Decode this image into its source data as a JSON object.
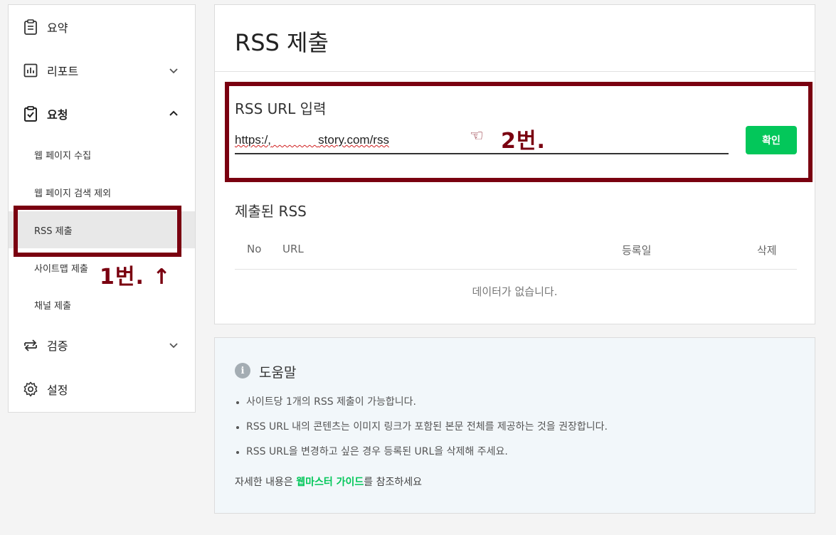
{
  "sidebar": {
    "items": [
      {
        "label": "요약",
        "icon": "clipboard-icon"
      },
      {
        "label": "리포트",
        "icon": "bar-chart-icon"
      },
      {
        "label": "요청",
        "icon": "clipboard-check-icon"
      },
      {
        "label": "검증",
        "icon": "swap-arrows-icon"
      },
      {
        "label": "설정",
        "icon": "gear-icon"
      }
    ],
    "sub_items": [
      "웹 페이지 수집",
      "웹 페이지 검색 제외",
      "RSS 제출",
      "사이트맵 제출",
      "채널 제출"
    ],
    "annotation": "1번.  ↑"
  },
  "main": {
    "title": "RSS 제출",
    "url_section": {
      "label": "RSS URL 입력",
      "value_prefix": "https:/,",
      "value_suffix": "story.com/rss",
      "pointer": "☜",
      "annotation": "2번.",
      "confirm_label": "확인"
    },
    "submitted": {
      "title": "제출된 RSS",
      "columns": [
        "No",
        "URL",
        "등록일",
        "삭제"
      ],
      "empty_message": "데이터가 없습니다."
    }
  },
  "help": {
    "icon_glyph": "i",
    "title": "도움말",
    "items": [
      "사이트당 1개의 RSS 제출이 가능합니다.",
      "RSS URL 내의 콘텐츠는 이미지 링크가 포함된 본문 전체를 제공하는 것을 권장합니다.",
      "RSS URL을 변경하고 싶은 경우 등록된 URL을 삭제해 주세요."
    ],
    "footer_prefix": "자세한 내용은 ",
    "footer_link": "웹마스터 가이드",
    "footer_suffix": "를 참조하세요"
  },
  "colors": {
    "accent_green": "#03c75a",
    "annotation_red": "#7a0010"
  }
}
